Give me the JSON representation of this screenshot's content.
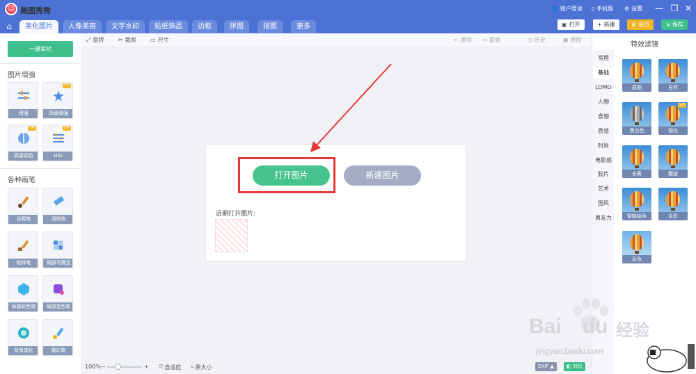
{
  "app": {
    "title": "美图秀秀",
    "logo_glyph": "☺"
  },
  "titlebar": {
    "login": "账户登录",
    "mobile": "手机版",
    "settings": "设置"
  },
  "window": {
    "minimize": "—",
    "restore": "❐",
    "close": "✕"
  },
  "tabs": [
    {
      "label": "美化图片",
      "active": true
    },
    {
      "label": "人像美容"
    },
    {
      "label": "文字水印"
    },
    {
      "label": "贴纸饰品"
    },
    {
      "label": "边框"
    },
    {
      "label": "拼图"
    },
    {
      "label": "抠图"
    },
    {
      "label": "更多"
    }
  ],
  "actions": {
    "open": "打开",
    "new": "新建",
    "member": "会员",
    "save": "保存"
  },
  "sidebar": {
    "one_key": "一键美化",
    "enhance_title": "图片增强",
    "enhance": [
      {
        "label": "增强",
        "vip": false,
        "icon": "sliders-icon"
      },
      {
        "label": "高级增强",
        "vip": true,
        "icon": "magic-wand-icon"
      },
      {
        "label": "高级调色",
        "vip": true,
        "icon": "color-palette-icon"
      },
      {
        "label": "HSL",
        "vip": true,
        "icon": "sliders-icon"
      }
    ],
    "brush_title": "各种画笔",
    "brushes": [
      {
        "label": "涂鸦笔",
        "icon": "brush-icon"
      },
      {
        "label": "消除笔",
        "icon": "eraser-icon"
      },
      {
        "label": "取样笔",
        "icon": "sample-brush-icon"
      },
      {
        "label": "局部马赛克",
        "icon": "mosaic-icon"
      },
      {
        "label": "局部彩色笔",
        "icon": "color-brush-icon"
      },
      {
        "label": "局部变色笔",
        "icon": "recolor-brush-icon"
      },
      {
        "label": "背景虚化",
        "icon": "blur-icon"
      },
      {
        "label": "魔幻笔",
        "icon": "magic-brush-icon"
      }
    ],
    "vip_badge": "VIP"
  },
  "toolbar": {
    "rotate": "旋转",
    "crop": "裁剪",
    "size": "尺寸",
    "undo": "撤销",
    "redo": "重做",
    "history": "历史",
    "original": "原图"
  },
  "canvas": {
    "open_picture": "打开图片",
    "new_picture": "新建图片",
    "recent_label": "近期打开图片:"
  },
  "filters": {
    "title": "特效滤镜",
    "categories": [
      {
        "label": "常用"
      },
      {
        "label": "基础",
        "active": true
      },
      {
        "label": "LOMO"
      },
      {
        "label": "人物"
      },
      {
        "label": "食物"
      },
      {
        "label": "质感"
      },
      {
        "label": "时尚"
      },
      {
        "label": "电影感"
      },
      {
        "label": "胶片"
      },
      {
        "label": "艺术"
      },
      {
        "label": "国风"
      },
      {
        "label": "男友力"
      }
    ],
    "items": [
      {
        "label": "原图"
      },
      {
        "label": "自然"
      },
      {
        "label": "黑白色",
        "vip": false
      },
      {
        "label": "锐化",
        "vip": true
      },
      {
        "label": "去雾"
      },
      {
        "label": "鞭波"
      },
      {
        "label": "智能绘色"
      },
      {
        "label": "全彩"
      },
      {
        "label": "反色"
      }
    ]
  },
  "status": {
    "zoom": "100%",
    "minus": "−",
    "plus": "+",
    "fit": "自适应",
    "actual": "原大小",
    "exif": "EXIF ▲",
    "compare": "对比"
  },
  "watermark": {
    "brand": "Bai",
    "brand2": "du",
    "cn": "经验",
    "url": "jingyan.baidu.com"
  },
  "colors": {
    "primary": "#4d72d6",
    "green": "#47c38e",
    "red": "#e53935",
    "gold": "#f2b526"
  }
}
